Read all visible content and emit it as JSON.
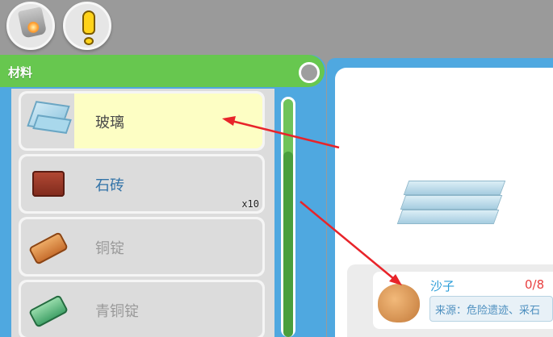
{
  "panel": {
    "title": "材料"
  },
  "items": [
    {
      "name": "玻璃",
      "icon": "glass-icon",
      "count": ""
    },
    {
      "name": "石砖",
      "icon": "brick-icon",
      "count": "x10"
    },
    {
      "name": "铜锭",
      "icon": "copper-ingot-icon",
      "count": ""
    },
    {
      "name": "青铜锭",
      "icon": "bronze-ingot-icon",
      "count": ""
    }
  ],
  "detail": {
    "ingredient": {
      "name": "沙子",
      "quantity": "0/8",
      "source": "来源：危险遗迹、采石"
    }
  },
  "colors": {
    "accent_green": "#67c74f",
    "panel_blue": "#4fa8e0",
    "arrow_red": "#e8242a"
  }
}
